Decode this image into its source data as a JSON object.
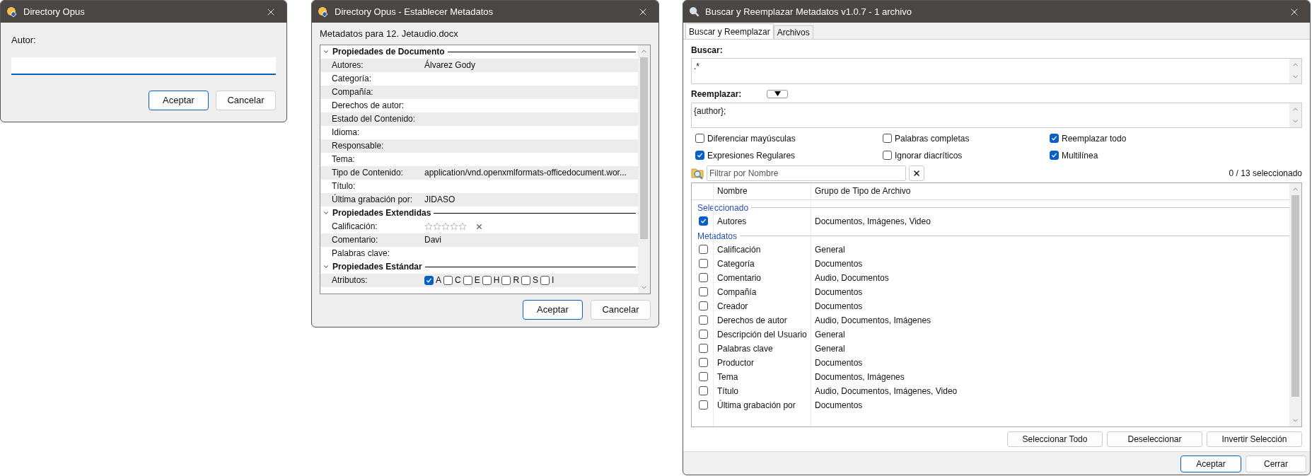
{
  "author_dialog": {
    "title": "Directory Opus",
    "label": "Autor:",
    "buttons": [
      {
        "label": "Aceptar",
        "default": true
      },
      {
        "label": "Cancelar",
        "default": false
      }
    ]
  },
  "metadata_dialog": {
    "title": "Directory Opus - Establecer Metadatos",
    "heading": "Metadatos para 12. Jetaudio.docx",
    "sections": [
      {
        "title": "Propiedades de Documento",
        "expanded": true,
        "rows": [
          {
            "kind": "text",
            "label": "Autores:",
            "value": "Álvarez Gody"
          },
          {
            "kind": "text",
            "label": "Categoría:"
          },
          {
            "kind": "text",
            "label": "Compañía:"
          },
          {
            "kind": "text",
            "label": "Derechos de autor:"
          },
          {
            "kind": "text",
            "label": "Estado del Contenido:"
          },
          {
            "kind": "text",
            "label": "Idioma:"
          },
          {
            "kind": "text",
            "label": "Responsable:"
          },
          {
            "kind": "text",
            "label": "Tema:"
          },
          {
            "kind": "text",
            "label": "Tipo de Contenido:",
            "value": "application/vnd.openxmlformats-officedocument.wor..."
          },
          {
            "kind": "text",
            "label": "Título:"
          },
          {
            "kind": "text",
            "label": "Última grabación por:",
            "value": "JIDASO"
          }
        ]
      },
      {
        "title": "Propiedades Extendidas",
        "expanded": true,
        "rows": [
          {
            "kind": "rating",
            "label": "Calificación:",
            "stars": 0
          },
          {
            "kind": "text",
            "label": "Comentario:",
            "value": "Davi"
          },
          {
            "kind": "text",
            "label": "Palabras clave:"
          }
        ]
      },
      {
        "title": "Propiedades Estándar",
        "expanded": true,
        "rows": [
          {
            "kind": "attributes",
            "label": "Atributos:",
            "flags": [
              {
                "label": "A",
                "checked": true
              },
              {
                "label": "C",
                "checked": false
              },
              {
                "label": "E",
                "checked": false
              },
              {
                "label": "H",
                "checked": false
              },
              {
                "label": "R",
                "checked": false
              },
              {
                "label": "S",
                "checked": false
              },
              {
                "label": "I",
                "checked": false
              }
            ]
          }
        ]
      }
    ],
    "buttons": [
      {
        "label": "Aceptar",
        "default": true
      },
      {
        "label": "Cancelar",
        "default": false
      }
    ]
  },
  "search_replace_dialog": {
    "title": "Buscar y Reemplazar Metadatos v1.0.7 - 1 archivo",
    "tabs": [
      {
        "label": "Buscar y Reemplazar",
        "selected": true
      },
      {
        "label": "Archivos",
        "selected": false
      }
    ],
    "find": {
      "label": "Buscar:",
      "value": ".*"
    },
    "replace": {
      "label": "Reemplazar:",
      "value": "{author};"
    },
    "options": [
      {
        "label": "Diferenciar mayúsculas",
        "checked": false
      },
      {
        "label": "Palabras completas",
        "checked": false
      },
      {
        "label": "Reemplazar todo",
        "checked": true
      },
      {
        "label": "Expresiones Regulares",
        "checked": true
      },
      {
        "label": "Ignorar diacríticos",
        "checked": false
      },
      {
        "label": "Multilínea",
        "checked": true
      }
    ],
    "filter": {
      "placeholder": "Filtrar por Nombre"
    },
    "count": "0 / 13 seleccionado",
    "table": {
      "columns": [
        "Nombre",
        "Grupo de Tipo de Archivo"
      ],
      "groups": [
        {
          "title": "Seleccionado",
          "rows": [
            {
              "name": "Autores",
              "group": "Documentos, Imágenes, Video",
              "checked": true
            }
          ]
        },
        {
          "title": "Metadatos",
          "rows": [
            {
              "name": "Calificación",
              "group": "General",
              "checked": false
            },
            {
              "name": "Categoría",
              "group": "Documentos",
              "checked": false
            },
            {
              "name": "Comentario",
              "group": "Audio, Documentos",
              "checked": false
            },
            {
              "name": "Compañía",
              "group": "Documentos",
              "checked": false
            },
            {
              "name": "Creador",
              "group": "Documentos",
              "checked": false
            },
            {
              "name": "Derechos de autor",
              "group": "Audio, Documentos, Imágenes",
              "checked": false
            },
            {
              "name": "Descripción del Usuario",
              "group": "General",
              "checked": false
            },
            {
              "name": "Palabras clave",
              "group": "General",
              "checked": false
            },
            {
              "name": "Productor",
              "group": "Documentos",
              "checked": false
            },
            {
              "name": "Tema",
              "group": "Documentos, Imágenes",
              "checked": false
            },
            {
              "name": "Título",
              "group": "Audio, Documentos, Imágenes, Video",
              "checked": false
            },
            {
              "name": "Última grabación por",
              "group": "Documentos",
              "checked": false
            }
          ]
        }
      ]
    },
    "list_buttons": [
      "Seleccionar Todo",
      "Deseleccionar",
      "Invertir Selección"
    ],
    "buttons": [
      {
        "label": "Aceptar",
        "default": true
      },
      {
        "label": "Cerrar",
        "default": false
      }
    ]
  }
}
